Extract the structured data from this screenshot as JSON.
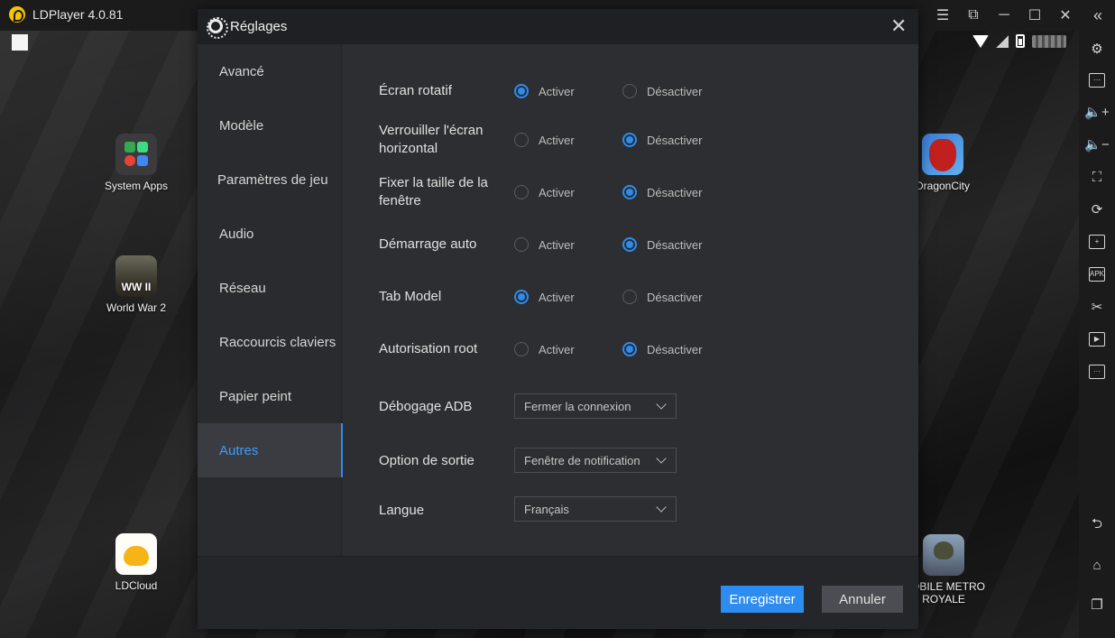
{
  "window": {
    "title": "LDPlayer 4.0.81",
    "controls": [
      "menu-icon",
      "sync-icon",
      "minimize-icon",
      "restore-icon",
      "close-icon"
    ],
    "collapse_icon": "double-chevron-left-icon"
  },
  "desktop": {
    "apps": [
      {
        "label": "System Apps",
        "icon": "system-apps-icon"
      },
      {
        "label": "World War 2",
        "icon": "world-war-2-icon",
        "badge": "WW II"
      },
      {
        "label": "LDCloud",
        "icon": "ldcloud-icon"
      },
      {
        "label": "DragonCity",
        "icon": "dragon-city-icon"
      },
      {
        "label": "MOBILE METRO ROYALE",
        "icon": "pubg-icon"
      }
    ]
  },
  "sidebar_tools": [
    "settings-icon",
    "keyboard-icon",
    "volume-up-icon",
    "volume-down-icon",
    "fullscreen-icon",
    "rotate-icon",
    "add-window-icon",
    "apk-icon",
    "scissors-icon",
    "video-icon",
    "more-icon",
    "back-icon",
    "home-icon",
    "recent-apps-icon"
  ],
  "dialog": {
    "title": "Réglages",
    "nav": [
      {
        "label": "Avancé"
      },
      {
        "label": "Modèle"
      },
      {
        "label": "Paramètres de jeu"
      },
      {
        "label": "Audio"
      },
      {
        "label": "Réseau"
      },
      {
        "label": "Raccourcis claviers"
      },
      {
        "label": "Papier peint"
      },
      {
        "label": "Autres",
        "active": true
      }
    ],
    "options": {
      "on_label": "Activer",
      "off_label": "Désactiver"
    },
    "settings": [
      {
        "label": "Écran rotatif",
        "value": "Activer"
      },
      {
        "label": "Verrouiller l'écran horizontal",
        "value": "Désactiver"
      },
      {
        "label": "Fixer la taille de la fenêtre",
        "value": "Désactiver"
      },
      {
        "label": "Démarrage auto",
        "value": "Désactiver"
      },
      {
        "label": "Tab Model",
        "value": "Activer"
      },
      {
        "label": "Autorisation root",
        "value": "Désactiver"
      }
    ],
    "selects": [
      {
        "label": "Débogage ADB",
        "value": "Fermer la connexion"
      },
      {
        "label": "Option de sortie",
        "value": "Fenêtre de notification"
      },
      {
        "label": "Langue",
        "value": "Français"
      }
    ],
    "buttons": {
      "save": "Enregistrer",
      "cancel": "Annuler"
    }
  }
}
